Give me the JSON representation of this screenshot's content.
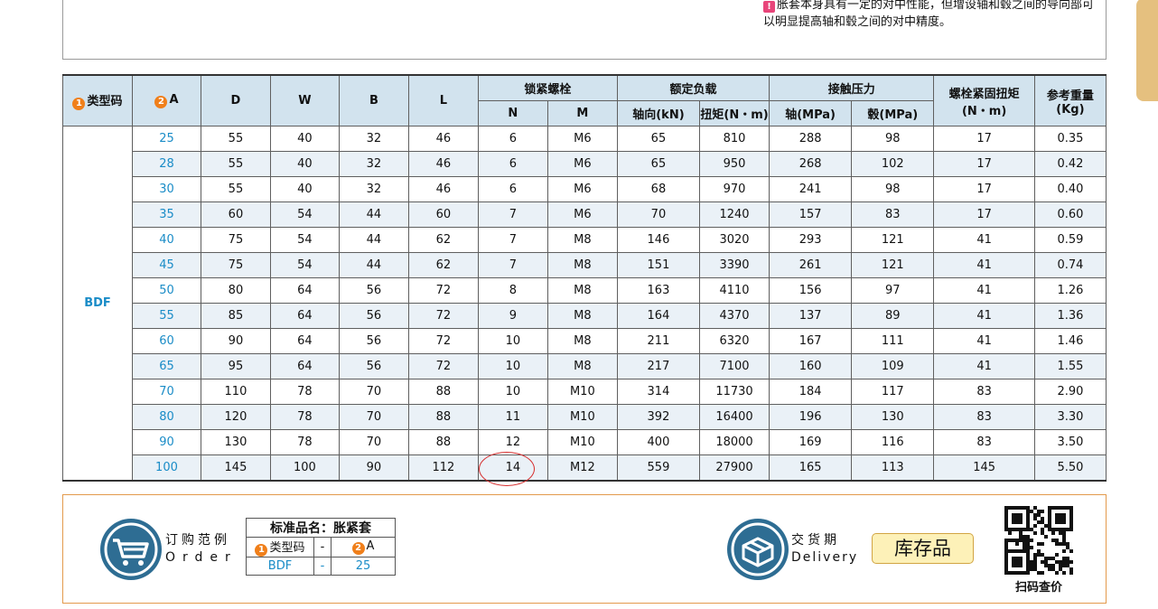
{
  "note": {
    "icon": "!",
    "text": "胀套本身具有一定的对中性能，但增设轴和毂之间的导向部可以明显提高轴和毂之间的对中精度。"
  },
  "table": {
    "headers": {
      "type_badge": "1",
      "type": "类型码",
      "a_badge": "2",
      "a": "A",
      "D": "D",
      "W": "W",
      "B": "B",
      "L": "L",
      "bolt": "锁紧螺栓",
      "N": "N",
      "M": "M",
      "rated": "额定负载",
      "axial": "轴向(kN)",
      "torque": "扭矩(N・m)",
      "pressure": "接触压力",
      "shaft": "轴(MPa)",
      "hub": "毂(MPa)",
      "tighten": "螺栓紧固扭矩",
      "tighten_unit": "(N・m)",
      "weight": "参考重量",
      "weight_unit": "(Kg)"
    },
    "type_value": "BDF",
    "rows": [
      [
        "25",
        "55",
        "40",
        "32",
        "46",
        "6",
        "M6",
        "65",
        "810",
        "288",
        "98",
        "17",
        "0.35"
      ],
      [
        "28",
        "55",
        "40",
        "32",
        "46",
        "6",
        "M6",
        "65",
        "950",
        "268",
        "102",
        "17",
        "0.42"
      ],
      [
        "30",
        "55",
        "40",
        "32",
        "46",
        "6",
        "M6",
        "68",
        "970",
        "241",
        "98",
        "17",
        "0.40"
      ],
      [
        "35",
        "60",
        "54",
        "44",
        "60",
        "7",
        "M6",
        "70",
        "1240",
        "157",
        "83",
        "17",
        "0.60"
      ],
      [
        "40",
        "75",
        "54",
        "44",
        "62",
        "7",
        "M8",
        "146",
        "3020",
        "293",
        "121",
        "41",
        "0.59"
      ],
      [
        "45",
        "75",
        "54",
        "44",
        "62",
        "7",
        "M8",
        "151",
        "3390",
        "261",
        "121",
        "41",
        "0.74"
      ],
      [
        "50",
        "80",
        "64",
        "56",
        "72",
        "8",
        "M8",
        "163",
        "4110",
        "156",
        "97",
        "41",
        "1.26"
      ],
      [
        "55",
        "85",
        "64",
        "56",
        "72",
        "9",
        "M8",
        "164",
        "4370",
        "137",
        "89",
        "41",
        "1.36"
      ],
      [
        "60",
        "90",
        "64",
        "56",
        "72",
        "10",
        "M8",
        "211",
        "6320",
        "167",
        "111",
        "41",
        "1.46"
      ],
      [
        "65",
        "95",
        "64",
        "56",
        "72",
        "10",
        "M8",
        "217",
        "7100",
        "160",
        "109",
        "41",
        "1.55"
      ],
      [
        "70",
        "110",
        "78",
        "70",
        "88",
        "10",
        "M10",
        "314",
        "11730",
        "184",
        "117",
        "83",
        "2.90"
      ],
      [
        "80",
        "120",
        "78",
        "70",
        "88",
        "11",
        "M10",
        "392",
        "16400",
        "196",
        "130",
        "83",
        "3.30"
      ],
      [
        "90",
        "130",
        "78",
        "70",
        "88",
        "12",
        "M10",
        "400",
        "18000",
        "169",
        "116",
        "83",
        "3.50"
      ],
      [
        "100",
        "145",
        "100",
        "90",
        "112",
        "14",
        "M12",
        "559",
        "27900",
        "165",
        "113",
        "145",
        "5.50"
      ]
    ]
  },
  "order": {
    "icon": "cart-icon",
    "label_cn": "订购范例",
    "label_en": "Order",
    "std_name": "标准品名：胀紧套",
    "type_badge": "1",
    "type_label": "类型码",
    "dash": "-",
    "a_badge": "2",
    "a_label": "A",
    "type_value": "BDF",
    "a_value": "25"
  },
  "delivery": {
    "icon": "box-icon",
    "label_cn": "交货期",
    "label_en": "Delivery",
    "stock": "库存品"
  },
  "qr": {
    "label": "扫码查价"
  },
  "colors": {
    "header_bg": "#d2e3ee",
    "accent_blue": "#1a8cc7",
    "badge_orange": "#f07f1a",
    "icon_circle": "#2e6d93",
    "frame_orange": "#e39a4c"
  }
}
